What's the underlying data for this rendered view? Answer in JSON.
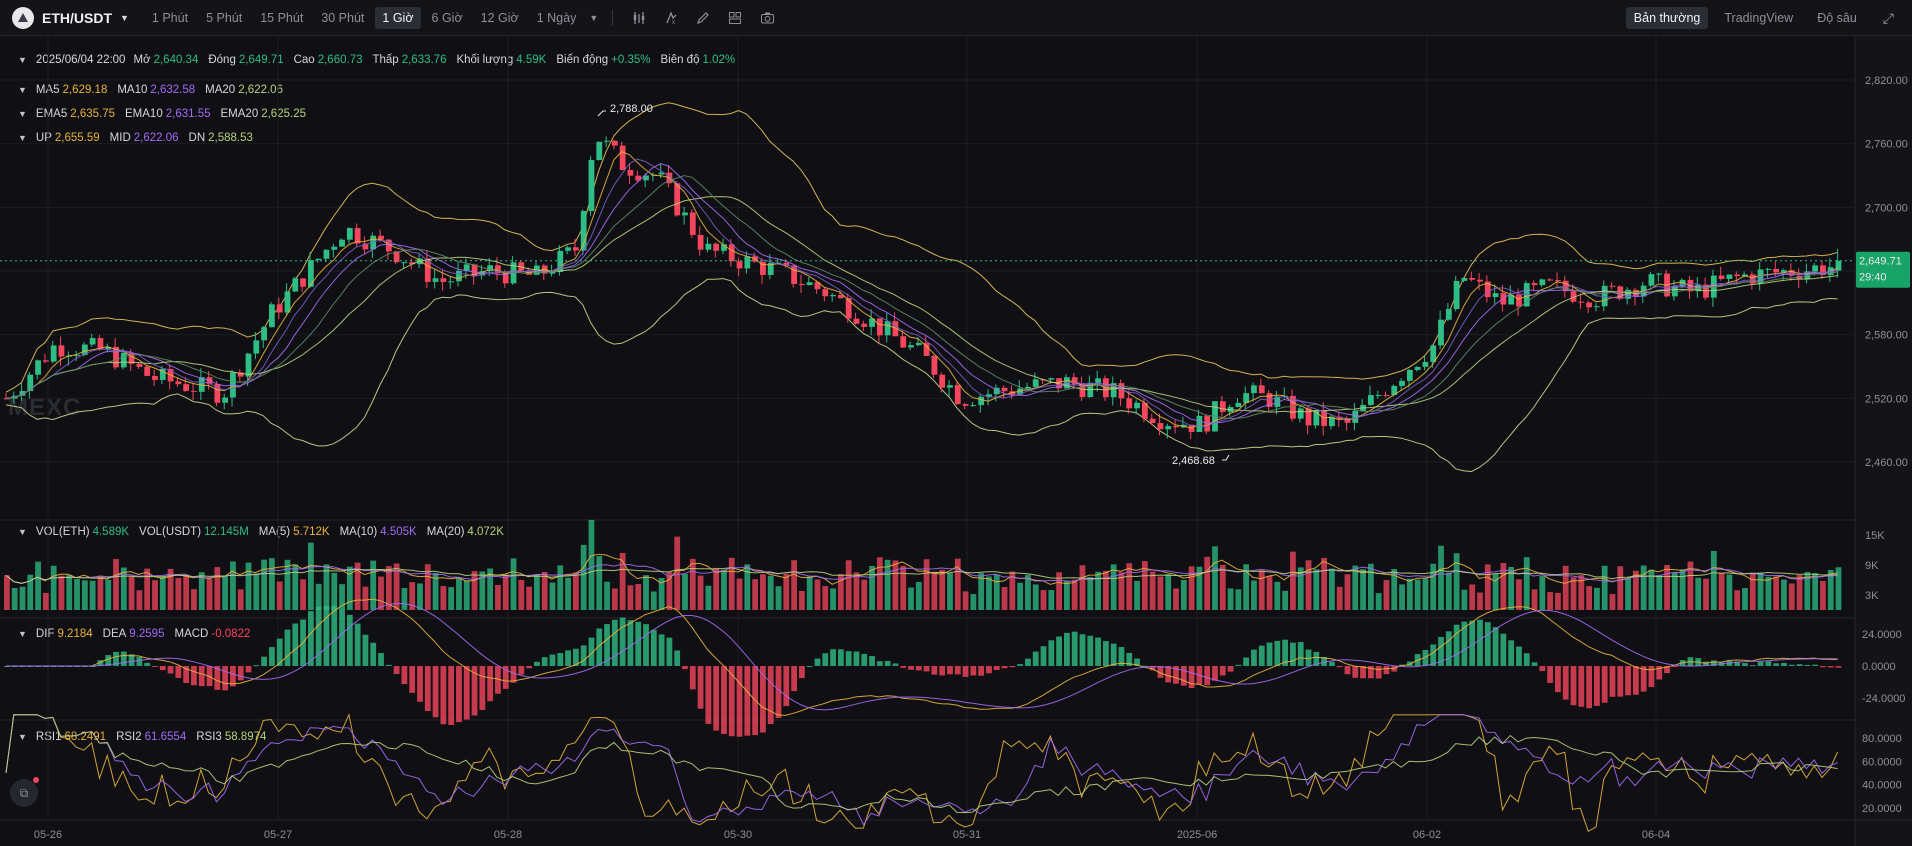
{
  "toolbar": {
    "symbol": "ETH/USDT",
    "symbol_icon": "ethereum-icon",
    "intervals": [
      "1 Phút",
      "5 Phút",
      "15 Phút",
      "30 Phút",
      "1 Giờ",
      "6 Giờ",
      "12 Giờ",
      "1 Ngày"
    ],
    "active_interval": "1 Giờ",
    "tools": [
      "indicator-icon",
      "formula-icon",
      "pencil-icon",
      "layout-icon",
      "camera-icon"
    ],
    "views": [
      "Bản thường",
      "TradingView",
      "Độ sâu"
    ],
    "active_view": "Bản thường"
  },
  "ohlc": {
    "time": "2025/06/04 22:00",
    "open_label": "Mở",
    "open": "2,640.34",
    "close_label": "Đóng",
    "close": "2,649.71",
    "high_label": "Cao",
    "high": "2,660.73",
    "low_label": "Thấp",
    "low": "2,633.76",
    "volume_label": "Khối lượng",
    "volume": "4.59K",
    "change_label": "Biến động",
    "change": "+0.35%",
    "amplitude_label": "Biên độ",
    "amplitude": "1.02%"
  },
  "ma": {
    "ma5_label": "MA5",
    "ma5": "2,629.18",
    "ma10_label": "MA10",
    "ma10": "2,632.58",
    "ma20_label": "MA20",
    "ma20": "2,622.06"
  },
  "ema": {
    "ema5_label": "EMA5",
    "ema5": "2,635.75",
    "ema10_label": "EMA10",
    "ema10": "2,631.55",
    "ema20_label": "EMA20",
    "ema20": "2,625.25"
  },
  "boll": {
    "up_label": "UP",
    "up": "2,655.59",
    "mid_label": "MID",
    "mid": "2,622.06",
    "dn_label": "DN",
    "dn": "2,588.53"
  },
  "vol": {
    "eth_label": "VOL(ETH)",
    "eth": "4.589K",
    "usdt_label": "VOL(USDT)",
    "usdt": "12.145M",
    "ma5_label": "MA(5)",
    "ma5": "5.712K",
    "ma10_label": "MA(10)",
    "ma10": "4.505K",
    "ma20_label": "MA(20)",
    "ma20": "4.072K"
  },
  "macd": {
    "dif_label": "DIF",
    "dif": "9.2184",
    "dea_label": "DEA",
    "dea": "9.2595",
    "macd_label": "MACD",
    "macd": "-0.0822"
  },
  "rsi": {
    "rsi1_label": "RSI1",
    "rsi1": "68.2491",
    "rsi2_label": "RSI2",
    "rsi2": "61.6554",
    "rsi3_label": "RSI3",
    "rsi3": "58.8974"
  },
  "price_axis": [
    "2,820.00",
    "2,760.00",
    "2,700.00",
    "2,580.00",
    "2,520.00",
    "2,460.00"
  ],
  "vol_axis": [
    "15K",
    "9K",
    "3K"
  ],
  "macd_axis": [
    "24.0000",
    "0.0000",
    "-24.0000"
  ],
  "rsi_axis": [
    "80.0000",
    "60.0000",
    "40.0000",
    "20.0000"
  ],
  "time_axis": [
    "05-26",
    "05-27",
    "05-28",
    "05-30",
    "05-31",
    "2025-06",
    "06-02",
    "06-04"
  ],
  "last_price": "2,649.71",
  "countdown": "29:40",
  "high_mark": "2,788.00",
  "low_mark": "2,468.68",
  "watermark": "MEXC",
  "colors": {
    "up": "#2ebd85",
    "down": "#f6465d",
    "ma5": "#e8b23a",
    "ma10": "#a26bf5",
    "ma20": "#b7d27a",
    "bg": "#101014"
  },
  "chart_data": {
    "type": "candlestick",
    "x_range": [
      "05-26",
      "06-04"
    ],
    "ylim": [
      2440,
      2840
    ],
    "series": [
      {
        "name": "MA5",
        "color": "#e8b23a"
      },
      {
        "name": "MA10",
        "color": "#a26bf5"
      },
      {
        "name": "MA20",
        "color": "#b7d27a"
      }
    ],
    "key_points": [
      {
        "x": "05-28",
        "y": 2788.0
      },
      {
        "x": "2025-06",
        "y": 2468.68
      },
      {
        "x": "06-04",
        "y": 2649.71
      }
    ]
  }
}
